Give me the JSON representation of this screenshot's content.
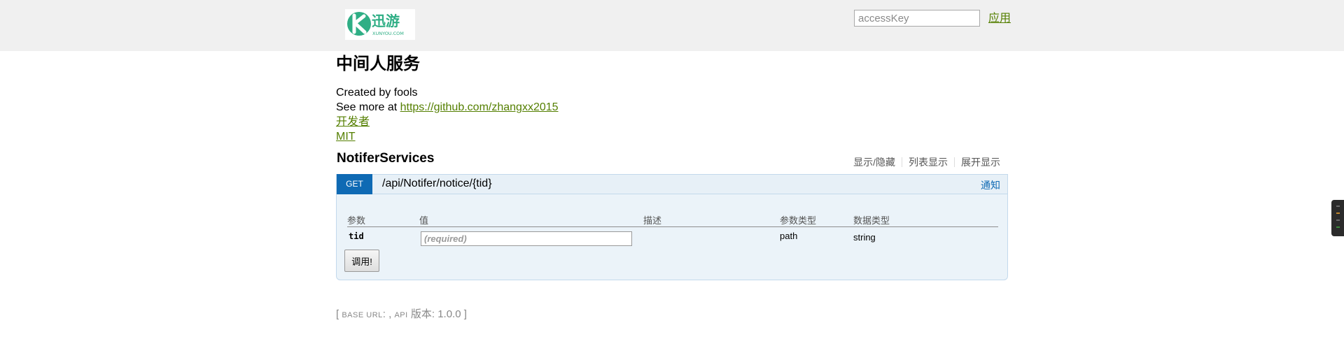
{
  "header": {
    "logo_alt": "迅游 XUNYOU.COM",
    "logo_text_cn": "迅游",
    "logo_text_en": "XUNYOU.COM",
    "api_key_placeholder": "accessKey",
    "apply_label": "应用",
    "colors": {
      "background": "#f0f0f0",
      "logo_green": "#2fae85",
      "link": "#547f00"
    }
  },
  "info": {
    "title": "中间人服务",
    "created_by": "Created by fools",
    "see_more_prefix": "See more at ",
    "see_more_link": "https://github.com/zhangxx2015",
    "developer_link": "开发者",
    "license_link": "MIT"
  },
  "resource": {
    "name": "NotiferServices",
    "actions": [
      "显示/隐藏",
      "列表显示",
      "展开显示"
    ],
    "operation": {
      "method": "GET",
      "path": "/api/Notifer/notice/{tid}",
      "summary": "通知",
      "colors": {
        "method_bg": "#0f6ab4",
        "heading_bg": "#e7f0f7",
        "content_bg": "#ebf3f9"
      }
    },
    "params": {
      "headers": [
        "参数",
        "值",
        "描述",
        "参数类型",
        "数据类型"
      ],
      "rows": [
        {
          "name": "tid",
          "value": "",
          "placeholder": "(required)",
          "description": "",
          "param_type": "path",
          "data_type": "string"
        }
      ]
    },
    "submit_label": "调用!"
  },
  "footer": {
    "open": "[ ",
    "base_url_label": "BASE URL",
    "base_url_value": ":",
    "sep": " , ",
    "api_label": "API",
    "version_label": " 版本: 1.0.0",
    "close": " ]"
  }
}
